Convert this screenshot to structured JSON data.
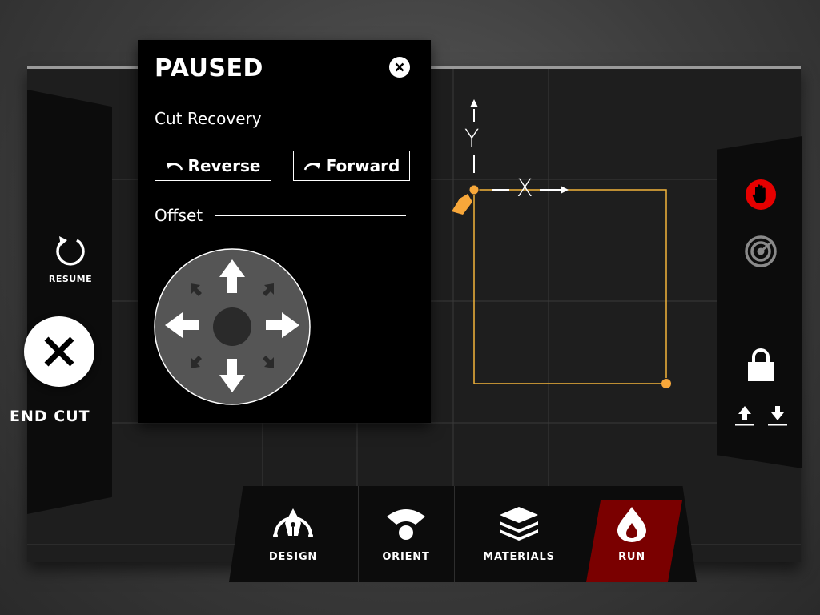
{
  "dialog": {
    "title": "PAUSED",
    "cut_recovery_label": "Cut Recovery",
    "reverse_label": "Reverse",
    "forward_label": "Forward",
    "offset_label": "Offset"
  },
  "left_panel": {
    "resume_label": "RESUME",
    "end_cut_label": "END CUT"
  },
  "canvas": {
    "x_axis_label": "X",
    "y_axis_label": "Y"
  },
  "nav": {
    "items": [
      {
        "label": "DESIGN",
        "icon": "pen-nib-icon"
      },
      {
        "label": "ORIENT",
        "icon": "orient-icon"
      },
      {
        "label": "MATERIALS",
        "icon": "layers-icon"
      },
      {
        "label": "RUN",
        "icon": "flame-icon"
      }
    ],
    "active": "RUN"
  },
  "colors": {
    "accent_orange": "#f7a73a",
    "cut_path": "#f2b43a",
    "stop_red": "#e60000",
    "run_active": "#7a0000"
  }
}
